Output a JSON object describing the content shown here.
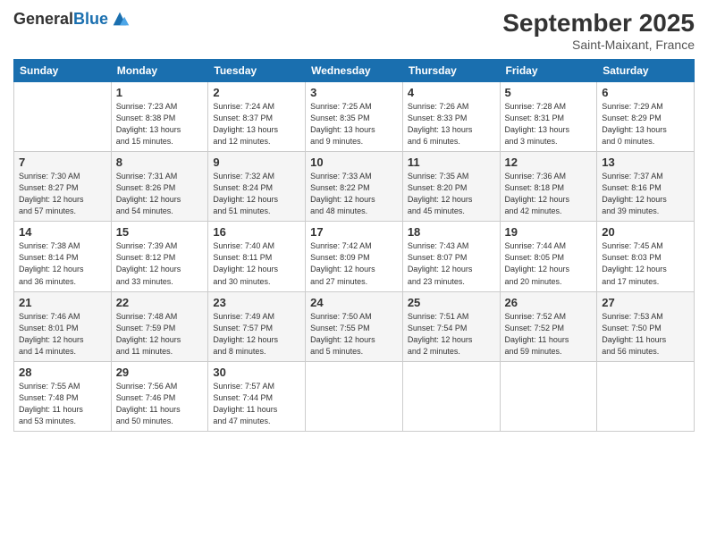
{
  "header": {
    "logo_general": "General",
    "logo_blue": "Blue",
    "month_title": "September 2025",
    "location": "Saint-Maixant, France"
  },
  "days_of_week": [
    "Sunday",
    "Monday",
    "Tuesday",
    "Wednesday",
    "Thursday",
    "Friday",
    "Saturday"
  ],
  "weeks": [
    [
      {
        "num": "",
        "info": ""
      },
      {
        "num": "1",
        "info": "Sunrise: 7:23 AM\nSunset: 8:38 PM\nDaylight: 13 hours\nand 15 minutes."
      },
      {
        "num": "2",
        "info": "Sunrise: 7:24 AM\nSunset: 8:37 PM\nDaylight: 13 hours\nand 12 minutes."
      },
      {
        "num": "3",
        "info": "Sunrise: 7:25 AM\nSunset: 8:35 PM\nDaylight: 13 hours\nand 9 minutes."
      },
      {
        "num": "4",
        "info": "Sunrise: 7:26 AM\nSunset: 8:33 PM\nDaylight: 13 hours\nand 6 minutes."
      },
      {
        "num": "5",
        "info": "Sunrise: 7:28 AM\nSunset: 8:31 PM\nDaylight: 13 hours\nand 3 minutes."
      },
      {
        "num": "6",
        "info": "Sunrise: 7:29 AM\nSunset: 8:29 PM\nDaylight: 13 hours\nand 0 minutes."
      }
    ],
    [
      {
        "num": "7",
        "info": "Sunrise: 7:30 AM\nSunset: 8:27 PM\nDaylight: 12 hours\nand 57 minutes."
      },
      {
        "num": "8",
        "info": "Sunrise: 7:31 AM\nSunset: 8:26 PM\nDaylight: 12 hours\nand 54 minutes."
      },
      {
        "num": "9",
        "info": "Sunrise: 7:32 AM\nSunset: 8:24 PM\nDaylight: 12 hours\nand 51 minutes."
      },
      {
        "num": "10",
        "info": "Sunrise: 7:33 AM\nSunset: 8:22 PM\nDaylight: 12 hours\nand 48 minutes."
      },
      {
        "num": "11",
        "info": "Sunrise: 7:35 AM\nSunset: 8:20 PM\nDaylight: 12 hours\nand 45 minutes."
      },
      {
        "num": "12",
        "info": "Sunrise: 7:36 AM\nSunset: 8:18 PM\nDaylight: 12 hours\nand 42 minutes."
      },
      {
        "num": "13",
        "info": "Sunrise: 7:37 AM\nSunset: 8:16 PM\nDaylight: 12 hours\nand 39 minutes."
      }
    ],
    [
      {
        "num": "14",
        "info": "Sunrise: 7:38 AM\nSunset: 8:14 PM\nDaylight: 12 hours\nand 36 minutes."
      },
      {
        "num": "15",
        "info": "Sunrise: 7:39 AM\nSunset: 8:12 PM\nDaylight: 12 hours\nand 33 minutes."
      },
      {
        "num": "16",
        "info": "Sunrise: 7:40 AM\nSunset: 8:11 PM\nDaylight: 12 hours\nand 30 minutes."
      },
      {
        "num": "17",
        "info": "Sunrise: 7:42 AM\nSunset: 8:09 PM\nDaylight: 12 hours\nand 27 minutes."
      },
      {
        "num": "18",
        "info": "Sunrise: 7:43 AM\nSunset: 8:07 PM\nDaylight: 12 hours\nand 23 minutes."
      },
      {
        "num": "19",
        "info": "Sunrise: 7:44 AM\nSunset: 8:05 PM\nDaylight: 12 hours\nand 20 minutes."
      },
      {
        "num": "20",
        "info": "Sunrise: 7:45 AM\nSunset: 8:03 PM\nDaylight: 12 hours\nand 17 minutes."
      }
    ],
    [
      {
        "num": "21",
        "info": "Sunrise: 7:46 AM\nSunset: 8:01 PM\nDaylight: 12 hours\nand 14 minutes."
      },
      {
        "num": "22",
        "info": "Sunrise: 7:48 AM\nSunset: 7:59 PM\nDaylight: 12 hours\nand 11 minutes."
      },
      {
        "num": "23",
        "info": "Sunrise: 7:49 AM\nSunset: 7:57 PM\nDaylight: 12 hours\nand 8 minutes."
      },
      {
        "num": "24",
        "info": "Sunrise: 7:50 AM\nSunset: 7:55 PM\nDaylight: 12 hours\nand 5 minutes."
      },
      {
        "num": "25",
        "info": "Sunrise: 7:51 AM\nSunset: 7:54 PM\nDaylight: 12 hours\nand 2 minutes."
      },
      {
        "num": "26",
        "info": "Sunrise: 7:52 AM\nSunset: 7:52 PM\nDaylight: 11 hours\nand 59 minutes."
      },
      {
        "num": "27",
        "info": "Sunrise: 7:53 AM\nSunset: 7:50 PM\nDaylight: 11 hours\nand 56 minutes."
      }
    ],
    [
      {
        "num": "28",
        "info": "Sunrise: 7:55 AM\nSunset: 7:48 PM\nDaylight: 11 hours\nand 53 minutes."
      },
      {
        "num": "29",
        "info": "Sunrise: 7:56 AM\nSunset: 7:46 PM\nDaylight: 11 hours\nand 50 minutes."
      },
      {
        "num": "30",
        "info": "Sunrise: 7:57 AM\nSunset: 7:44 PM\nDaylight: 11 hours\nand 47 minutes."
      },
      {
        "num": "",
        "info": ""
      },
      {
        "num": "",
        "info": ""
      },
      {
        "num": "",
        "info": ""
      },
      {
        "num": "",
        "info": ""
      }
    ]
  ]
}
